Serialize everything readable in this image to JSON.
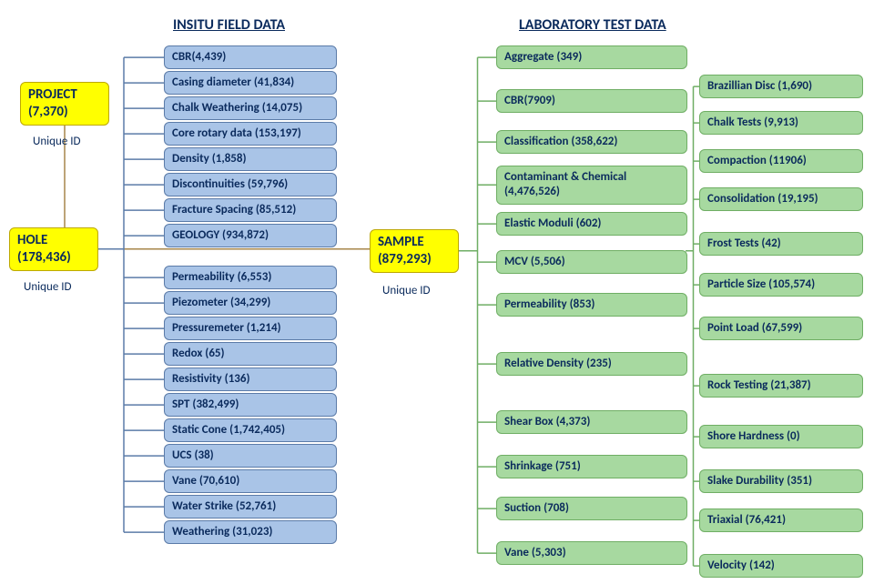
{
  "headers": {
    "field": "INSITU FIELD DATA",
    "lab": "LABORATORY  TEST  DATA"
  },
  "caption": "Unique ID",
  "yellow": {
    "project": {
      "label": "PROJECT\n(7,370)"
    },
    "hole": {
      "label": "HOLE\n(178,436)"
    },
    "sample": {
      "label": "SAMPLE\n(879,293)"
    }
  },
  "field": [
    {
      "label": "CBR(4,439)"
    },
    {
      "label": "Casing diameter (41,834)"
    },
    {
      "label": "Chalk Weathering (14,075)"
    },
    {
      "label": "Core rotary data (153,197)"
    },
    {
      "label": "Density (1,858)"
    },
    {
      "label": "Discontinuities (59,796)"
    },
    {
      "label": "Fracture Spacing (85,512)"
    },
    {
      "label": "GEOLOGY (934,872)"
    },
    {
      "label": "Permeability (6,553)"
    },
    {
      "label": "Piezometer (34,299)"
    },
    {
      "label": "Pressuremeter (1,214)"
    },
    {
      "label": "Redox (65)"
    },
    {
      "label": "Resistivity (136)"
    },
    {
      "label": "SPT (382,499)"
    },
    {
      "label": "Static Cone (1,742,405)"
    },
    {
      "label": "UCS (38)"
    },
    {
      "label": "Vane (70,610)"
    },
    {
      "label": "Water Strike (52,761)"
    },
    {
      "label": "Weathering (31,023)"
    }
  ],
  "lab_col1": [
    {
      "label": "Aggregate  (349)"
    },
    {
      "label": "CBR(7909)"
    },
    {
      "label": "Classification  (358,622)"
    },
    {
      "label": "Contaminant  & Chemical\n(4,476,526)"
    },
    {
      "label": "Elastic Moduli (602)"
    },
    {
      "label": "MCV (5,506)"
    },
    {
      "label": "Permeability (853)"
    },
    {
      "label": "Relative Density (235)"
    },
    {
      "label": "Shear Box (4,373)"
    },
    {
      "label": "Shrinkage  (751)"
    },
    {
      "label": "Suction  (708)"
    },
    {
      "label": "Vane (5,303)"
    }
  ],
  "lab_col2": [
    {
      "label": "Brazillian  Disc (1,690)"
    },
    {
      "label": "Chalk Tests (9,913)"
    },
    {
      "label": "Compaction  (11906)"
    },
    {
      "label": "Consolidation  (19,195)"
    },
    {
      "label": "Frost Tests (42)"
    },
    {
      "label": "Particle Size (105,574)"
    },
    {
      "label": "Point Load (67,599)"
    },
    {
      "label": "Rock Testing (21,387)"
    },
    {
      "label": "Shore Hardness (0)"
    },
    {
      "label": "Slake Durability  (351)"
    },
    {
      "label": "Triaxial  (76,421)"
    },
    {
      "label": "Velocity (142)"
    }
  ],
  "colors": {
    "blueStroke": "#5b7ba8",
    "greenStroke": "#6fae64",
    "brownStroke": "#a7864a"
  }
}
